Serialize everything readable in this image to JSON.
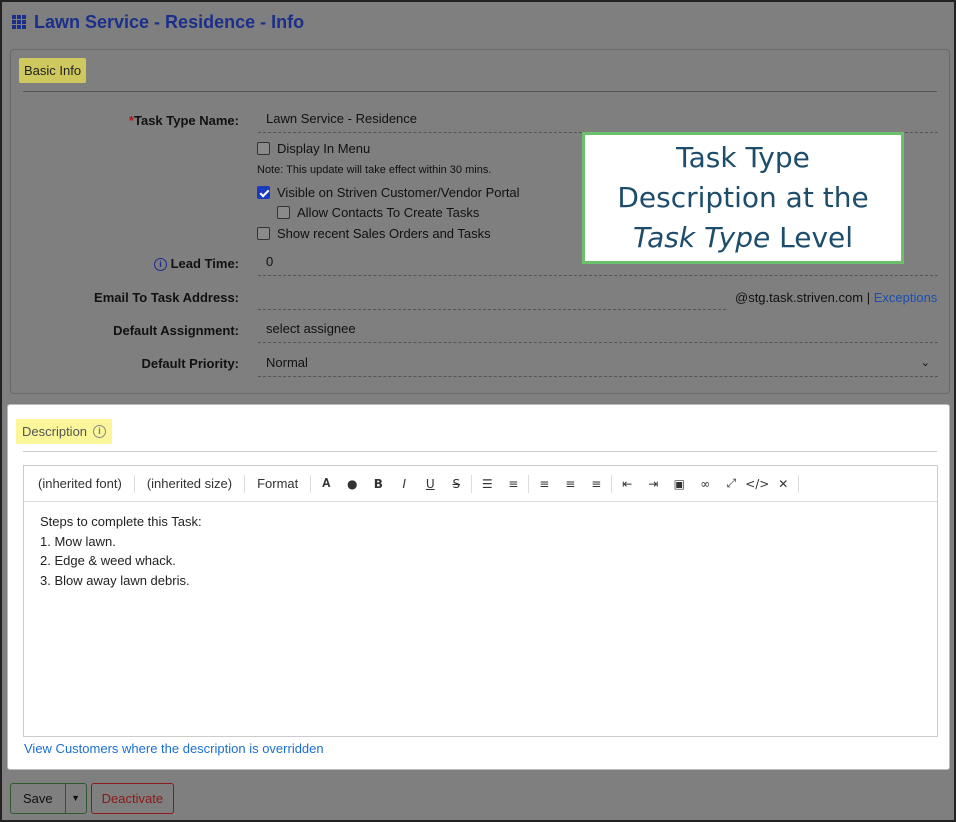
{
  "header": {
    "title": "Lawn Service - Residence - Info",
    "icon": "grid-icon"
  },
  "basic": {
    "section_label": "Basic Info",
    "task_type_name": {
      "required_mark": "*",
      "label": "Task Type Name:",
      "value": "Lawn Service - Residence"
    },
    "display_in_menu": {
      "label": "Display In Menu",
      "checked": false
    },
    "note": "Note: This update will take effect within 30 mins.",
    "visible_portal": {
      "label": "Visible on Striven Customer/Vendor Portal",
      "checked": true
    },
    "allow_contacts": {
      "label": "Allow Contacts To Create Tasks",
      "checked": false
    },
    "show_recent": {
      "label": "Show recent Sales Orders and Tasks",
      "checked": false
    },
    "lead_time": {
      "label": "Lead Time:",
      "value": "0"
    },
    "email_to_task": {
      "label": "Email To Task Address:",
      "value": "",
      "suffix": "@stg.task.striven.com",
      "divider": "|",
      "exceptions_link": "Exceptions"
    },
    "default_assignment": {
      "label": "Default Assignment:",
      "value": "select assignee"
    },
    "default_priority": {
      "label": "Default Priority:",
      "value": "Normal"
    }
  },
  "callout": {
    "line1": "Task Type",
    "line2": "Description at the",
    "line3_italic": "Task Type",
    "line3_rest": " Level"
  },
  "description": {
    "section_label": "Description",
    "toolbar": {
      "font": "(inherited font)",
      "size": "(inherited size)",
      "format": "Format"
    },
    "content": [
      "Steps to complete this Task:",
      "1. Mow lawn.",
      "2. Edge & weed whack.",
      "3. Blow away lawn debris."
    ],
    "override_link": "View Customers where the description is overridden"
  },
  "actions": {
    "save": "Save",
    "deactivate": "Deactivate"
  },
  "colors": {
    "title": "#1b2f8a",
    "highlight": "#fbf69a",
    "callout_border": "#6cc06c",
    "callout_text": "#1e4d6b",
    "link": "#1b6fd1"
  }
}
